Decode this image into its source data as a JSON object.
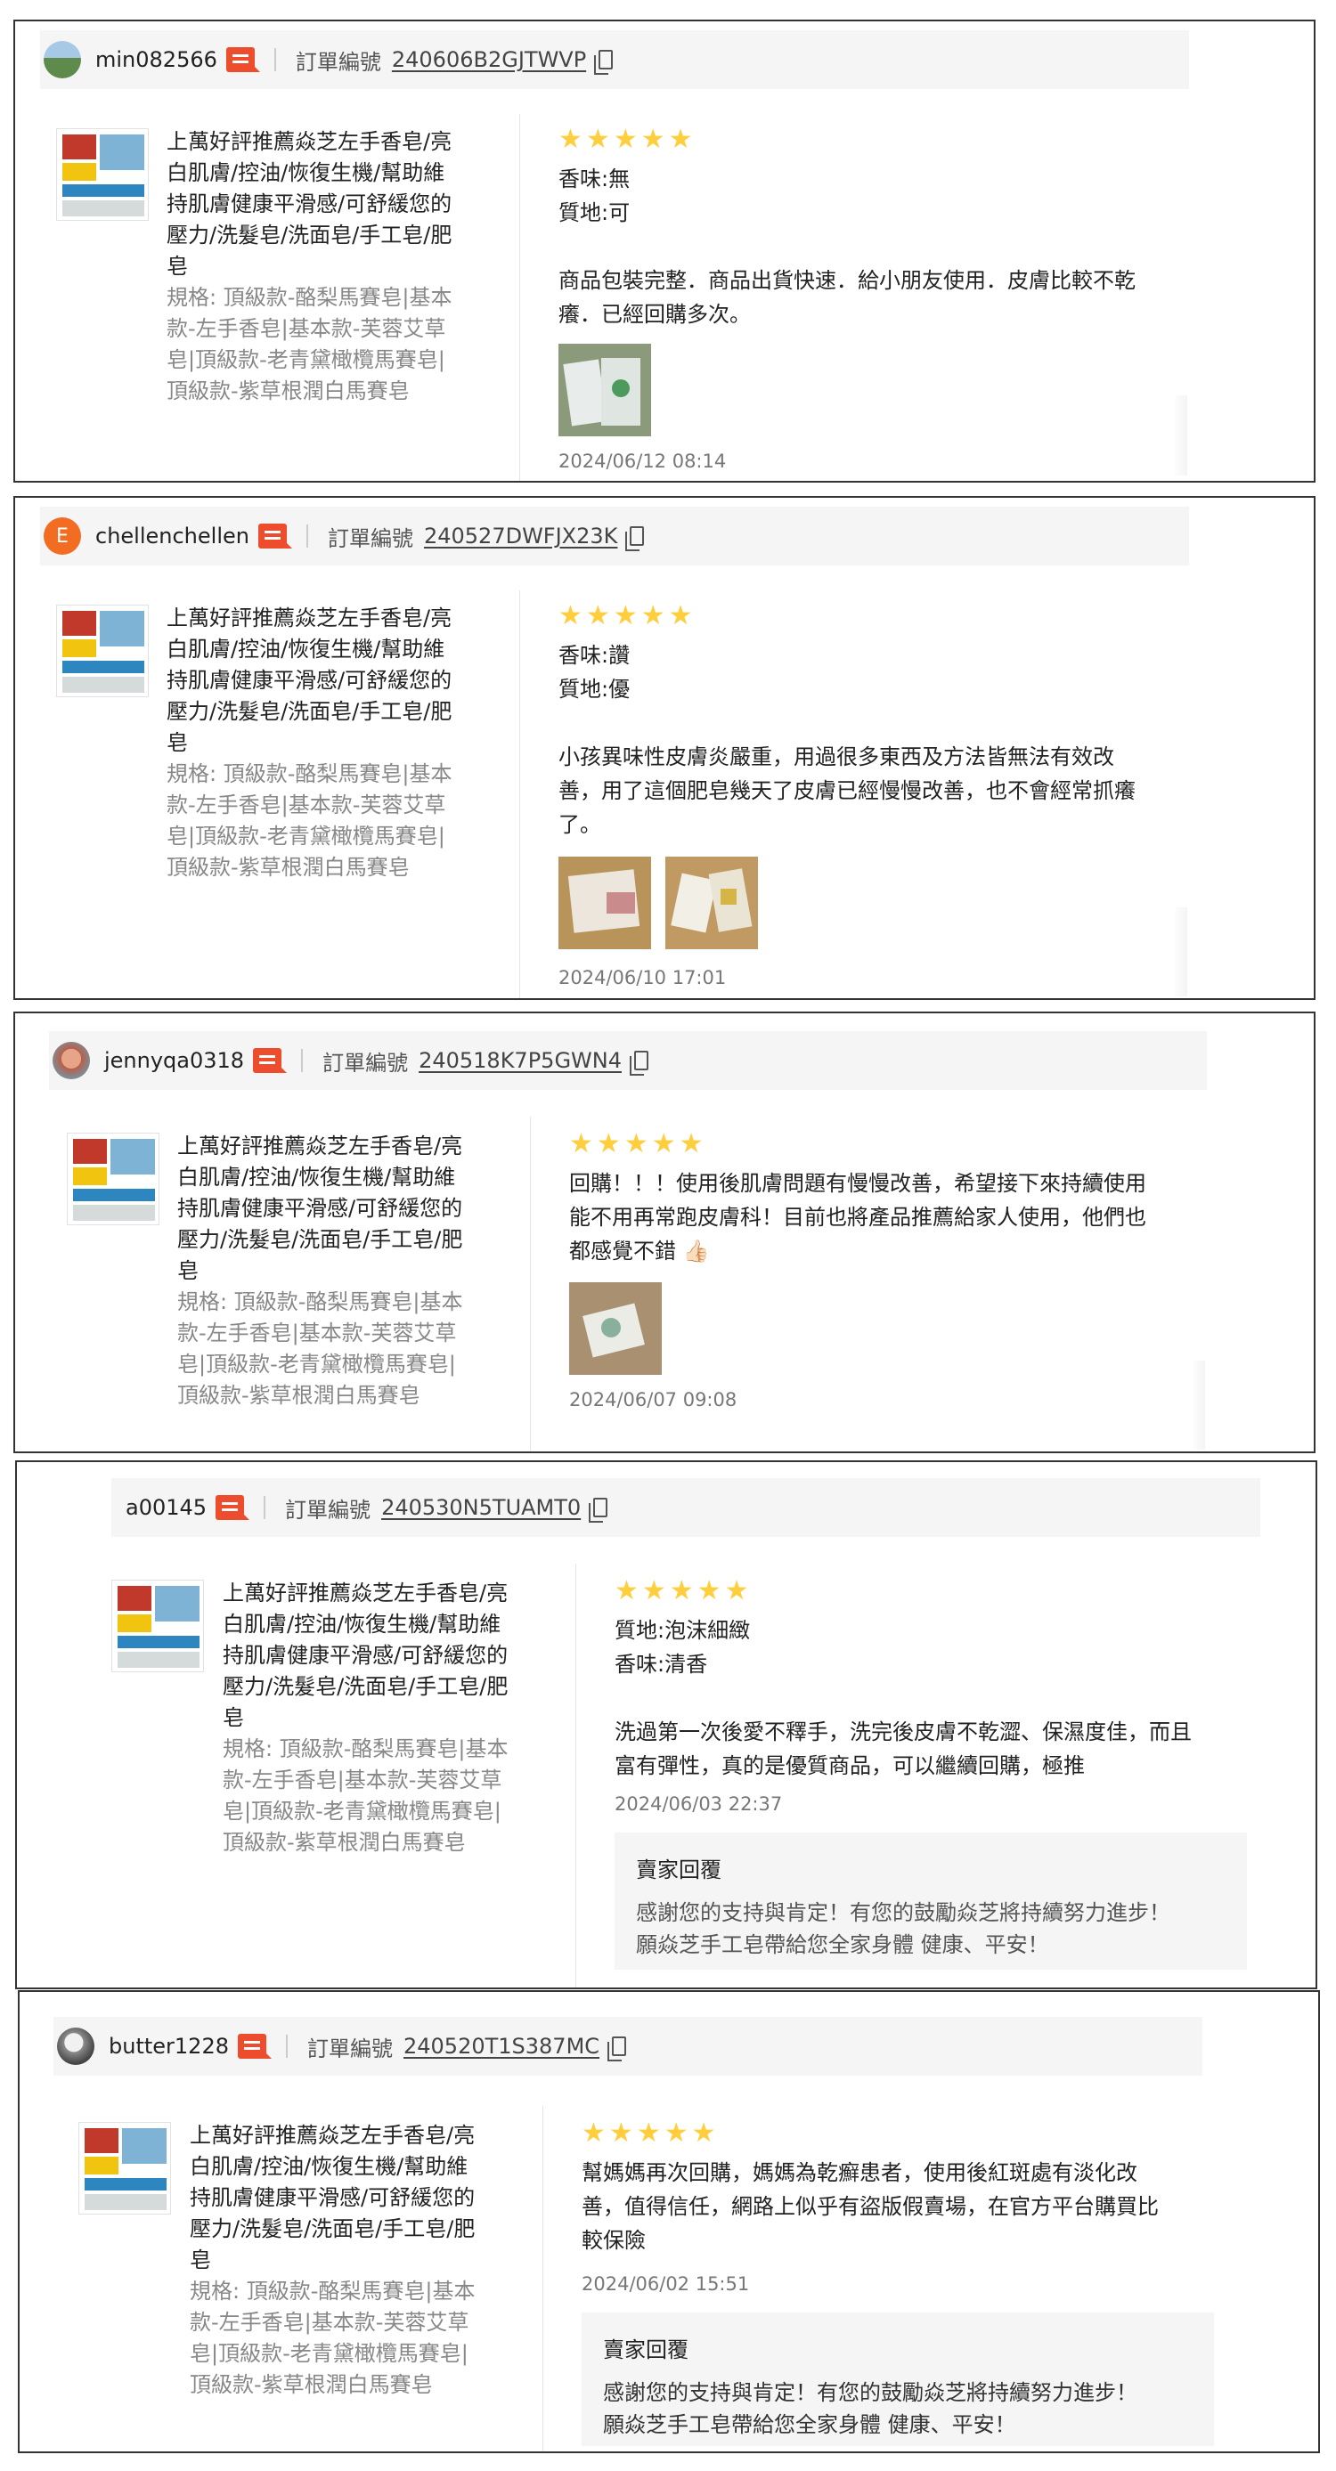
{
  "product": {
    "title_lines": [
      "上萬好評推薦焱芝左手香皂/亮",
      "白肌膚/控油/恢復生機/幫助維",
      "持肌膚健康平滑感/可舒緩您的",
      "壓力/洗髮皂/洗面皂/手工皂/肥",
      "皂"
    ],
    "spec_lines": [
      "規格: 頂級款-酪梨馬賽皂|基本",
      "款-左手香皂|基本款-芙蓉艾草",
      "皂|頂級款-老青黛橄欖馬賽皂|",
      "頂級款-紫草根潤白馬賽皂"
    ]
  },
  "labels": {
    "order": "訂單編號",
    "seller_reply": "賣家回覆"
  },
  "stars_count": 5,
  "reviews": [
    {
      "username": "min082566",
      "avatar_color": "#6a8d5a",
      "order_no": "240606B2GJTWVP",
      "lines": [
        "香味:無",
        "質地:可",
        "",
        "商品包裝完整．商品出貨快速．給小朋友使用．皮膚比較不乾",
        "癢．已經回購多次。"
      ],
      "date": "2024/06/12 08:14"
    },
    {
      "username": "chellenchellen",
      "avatar_letter": "E",
      "avatar_color": "#f26c22",
      "order_no": "240527DWFJX23K",
      "lines": [
        "香味:讚",
        "質地:優",
        "",
        "小孩異味性皮膚炎嚴重，用過很多東西及方法皆無法有效改",
        "善，用了這個肥皂幾天了皮膚已經慢慢改善，也不會經常抓癢",
        "了。"
      ],
      "date": "2024/06/10 17:01"
    },
    {
      "username": "jennyqa0318",
      "avatar_color": "#d9886e",
      "order_no": "240518K7P5GWN4",
      "lines": [
        "回購！！！使用後肌膚問題有慢慢改善，希望接下來持續使用",
        "能不用再常跑皮膚科！目前也將產品推薦給家人使用，他們也",
        "都感覺不錯 👍🏻"
      ],
      "date": "2024/06/07 09:08"
    },
    {
      "username": "a00145",
      "order_no": "240530N5TUAMT0",
      "lines": [
        "質地:泡沫細緻",
        "香味:清香",
        "",
        "洗過第一次後愛不釋手，洗完後皮膚不乾澀、保濕度佳，而且",
        "富有彈性，真的是優質商品，可以繼續回購，極推"
      ],
      "date": "2024/06/03 22:37",
      "reply": [
        "感謝您的支持與肯定！有您的鼓勵焱芝將持續努力進步！",
        "願焱芝手工皂帶給您全家身體 健康、平安！"
      ]
    },
    {
      "username": "butter1228",
      "avatar_color": "#777777",
      "order_no": "240520T1S387MC",
      "lines": [
        "幫媽媽再次回購，媽媽為乾癬患者，使用後紅斑處有淡化改",
        "善，值得信任，網路上似乎有盜版假賣場，在官方平台購買比",
        "較保險"
      ],
      "date": "2024/06/02 15:51",
      "reply": [
        "感謝您的支持與肯定！有您的鼓勵焱芝將持續努力進步！",
        "願焱芝手工皂帶給您全家身體 健康、平安！"
      ]
    }
  ]
}
